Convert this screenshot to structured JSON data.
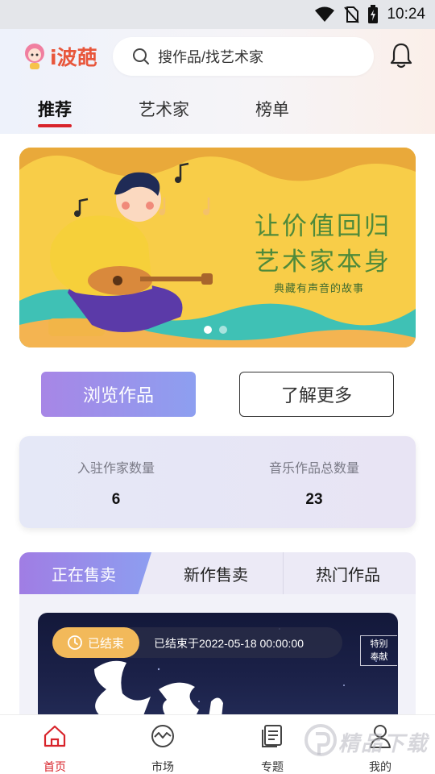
{
  "status_bar": {
    "time": "10:24",
    "icons": [
      "wifi-icon",
      "no-sim-icon",
      "battery-charging-icon"
    ]
  },
  "header": {
    "logo_text": "i波葩",
    "search_placeholder": "搜作品/找艺术家",
    "notification_icon": "bell-icon"
  },
  "tabs": [
    {
      "label": "推荐",
      "active": true
    },
    {
      "label": "艺术家",
      "active": false
    },
    {
      "label": "榜单",
      "active": false
    }
  ],
  "banner": {
    "title_line1": "让价值回归",
    "title_line2": "艺术家本身",
    "subtitle": "典藏有声音的故事",
    "slide_count": 2,
    "active_slide": 1
  },
  "actions": {
    "browse_label": "浏览作品",
    "learn_more_label": "了解更多"
  },
  "stats": [
    {
      "label": "入驻作家数量",
      "value": "6"
    },
    {
      "label": "音乐作品总数量",
      "value": "23"
    }
  ],
  "sale_tabs": [
    {
      "label": "正在售卖",
      "active": true
    },
    {
      "label": "新作售卖",
      "active": false
    },
    {
      "label": "热门作品",
      "active": false
    }
  ],
  "work_card": {
    "status_label": "已结束",
    "ended_text": "已结束于2022-05-18 00:00:00",
    "tag_line1": "特别",
    "tag_line2": "奉献"
  },
  "bottom_nav": [
    {
      "label": "首页",
      "icon": "home-icon",
      "active": true
    },
    {
      "label": "市场",
      "icon": "market-icon",
      "active": false
    },
    {
      "label": "专题",
      "icon": "topics-icon",
      "active": false
    },
    {
      "label": "我的",
      "icon": "profile-icon",
      "active": false
    }
  ],
  "watermark": "精品下载",
  "colors": {
    "accent_red": "#d8232a",
    "gradient_purple": "#a786e6",
    "gradient_blue": "#8d9ff0",
    "ended_badge": "#f2b95a"
  }
}
